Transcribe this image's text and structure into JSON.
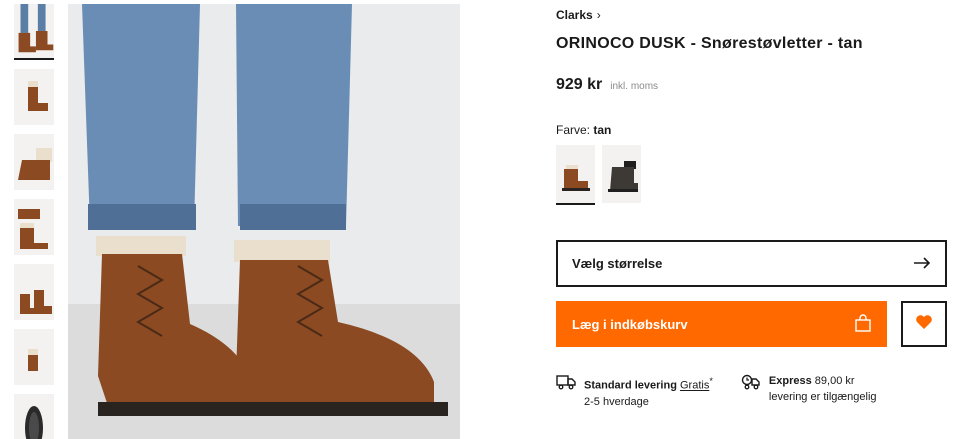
{
  "thumbnails": [
    {
      "alt": "thumbnail-1",
      "active": true
    },
    {
      "alt": "thumbnail-2",
      "active": false
    },
    {
      "alt": "thumbnail-3",
      "active": false
    },
    {
      "alt": "thumbnail-4",
      "active": false
    },
    {
      "alt": "thumbnail-5",
      "active": false
    },
    {
      "alt": "thumbnail-6",
      "active": false
    },
    {
      "alt": "thumbnail-7",
      "active": false
    }
  ],
  "product": {
    "brand": "Clarks",
    "title": "ORINOCO DUSK - Snørestøvletter - tan",
    "price": "929 kr",
    "vat_note": "inkl. moms",
    "color_label": "Farve:",
    "color_value": "tan"
  },
  "swatches": [
    {
      "name": "tan",
      "color": "#8b4a22",
      "active": true
    },
    {
      "name": "dark",
      "color": "#3d3a36",
      "active": false
    }
  ],
  "size_select": {
    "label": "Vælg størrelse",
    "icon": "arrow-right-icon"
  },
  "cart": {
    "label": "Læg i indkøbskurv",
    "icon": "shopping-bag-icon",
    "color": "#ff6900"
  },
  "wishlist": {
    "icon": "heart-icon",
    "color": "#ff6900"
  },
  "delivery": {
    "standard": {
      "title": "Standard levering",
      "price": "Gratis",
      "mark": "*",
      "time": "2-5 hverdage",
      "icon": "truck-icon"
    },
    "express": {
      "title": "Express",
      "price": "89,00 kr",
      "note": "levering er tilgængelig",
      "icon": "express-truck-icon"
    }
  }
}
